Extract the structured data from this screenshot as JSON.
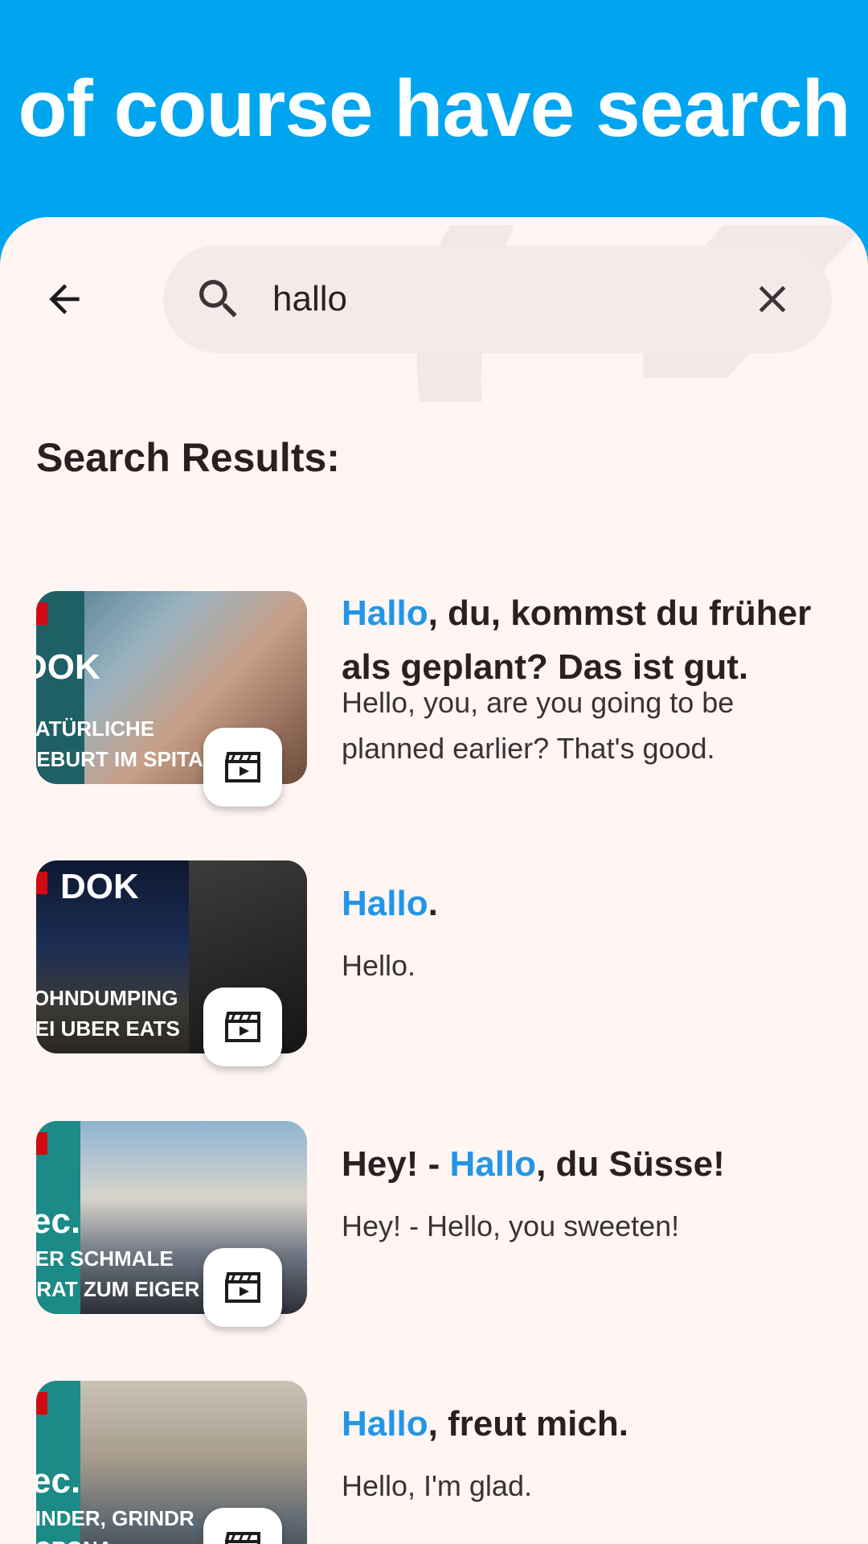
{
  "banner": {
    "title": "of course have search"
  },
  "search": {
    "query": "hallo",
    "back_icon": "arrow-left-icon",
    "search_icon": "search-icon",
    "clear_icon": "close-icon"
  },
  "results_heading": "Search Results:",
  "results": [
    {
      "title_highlight": "Hallo",
      "title_rest": ", du, kommst du früher als geplant? Das ist gut.",
      "translation": "Hello, you, are you going to be planned earlier? That's good.",
      "thumb_brand": "DOK",
      "thumb_caption_1": "NATÜRLICHE",
      "thumb_caption_2": "GEBURT IM SPITAL"
    },
    {
      "title_highlight": "Hallo",
      "title_rest": ".",
      "translation": "Hello.",
      "thumb_brand": "DOK",
      "thumb_caption_1": "LOHNDUMPING",
      "thumb_caption_2": "BEI UBER EATS"
    },
    {
      "title_prefix": "Hey! - ",
      "title_highlight": "Hallo",
      "title_rest": ", du Süsse!",
      "translation": "Hey! - Hello, you sweeten!",
      "thumb_brand": "ec.",
      "thumb_caption_1": "DER SCHMALE",
      "thumb_caption_2": "GRAT ZUM EIGER"
    },
    {
      "title_highlight": "Hallo",
      "title_rest": ", freut mich.",
      "translation": "Hello, I'm glad.",
      "thumb_brand": "ec.",
      "thumb_caption_1": "KINDER, GRINDR",
      "thumb_caption_2": "CORONA"
    }
  ],
  "colors": {
    "banner": "#00a5f0",
    "sheet": "#fff5f3",
    "highlight": "#2196e8",
    "text": "#2a2022"
  }
}
